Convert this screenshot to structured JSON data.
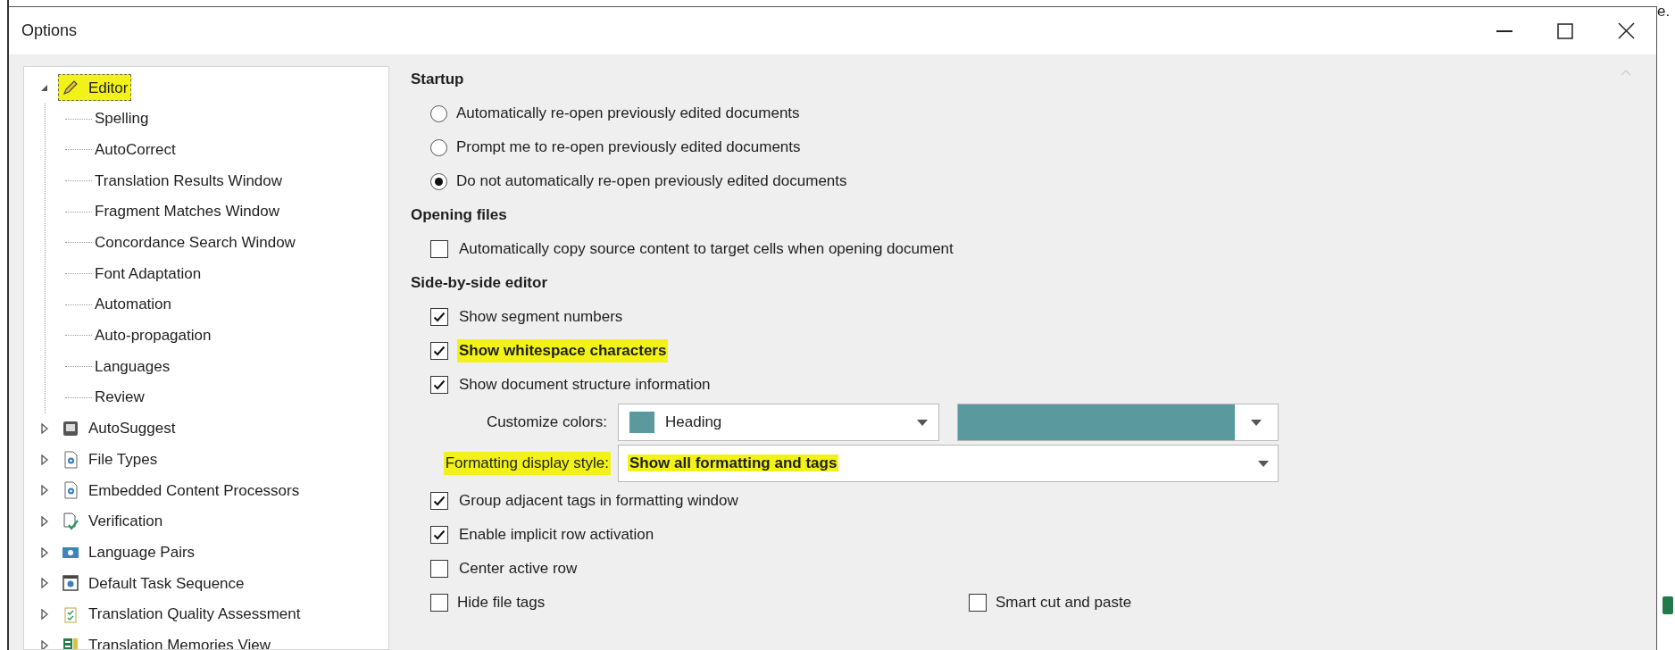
{
  "window": {
    "title": "Options"
  },
  "background_text": "e.",
  "tree": [
    {
      "label": "Editor",
      "expanded": true,
      "selected": true,
      "highlighted": true,
      "children": [
        {
          "label": "Spelling",
          "selected": false
        },
        {
          "label": "AutoCorrect",
          "selected": false
        },
        {
          "label": "Translation Results Window",
          "selected": false
        },
        {
          "label": "Fragment Matches Window",
          "selected": false
        },
        {
          "label": "Concordance Search Window",
          "selected": false
        },
        {
          "label": "Font Adaptation",
          "selected": false
        },
        {
          "label": "Automation",
          "selected": false
        },
        {
          "label": "Auto-propagation",
          "selected": false
        },
        {
          "label": "Languages",
          "selected": false
        },
        {
          "label": "Review",
          "selected": false
        }
      ]
    },
    {
      "label": "AutoSuggest",
      "expanded": false,
      "selected": false,
      "highlighted": false
    },
    {
      "label": "File Types",
      "expanded": false,
      "selected": false,
      "highlighted": false
    },
    {
      "label": "Embedded Content Processors",
      "expanded": false,
      "selected": false,
      "highlighted": false
    },
    {
      "label": "Verification",
      "expanded": false,
      "selected": false,
      "highlighted": false
    },
    {
      "label": "Language Pairs",
      "expanded": false,
      "selected": false,
      "highlighted": false
    },
    {
      "label": "Default Task Sequence",
      "expanded": false,
      "selected": false,
      "highlighted": false
    },
    {
      "label": "Translation Quality Assessment",
      "expanded": false,
      "selected": false,
      "highlighted": false
    },
    {
      "label": "Translation Memories View",
      "expanded": false,
      "selected": false,
      "highlighted": false
    }
  ],
  "sections": [
    {
      "heading": "Startup",
      "items": [
        {
          "kind": "radio",
          "label": "Automatically re-open previously edited documents",
          "selected": false
        },
        {
          "kind": "radio",
          "label": "Prompt me to re-open previously edited documents",
          "selected": false
        },
        {
          "kind": "radio",
          "label": "Do not automatically re-open previously edited documents",
          "selected": true
        }
      ]
    },
    {
      "heading": "Opening files",
      "items": [
        {
          "kind": "checkbox",
          "label": "Automatically copy source content to target cells when opening document",
          "checked": false,
          "highlighted": false
        }
      ]
    },
    {
      "heading": "Side-by-side editor",
      "items": [
        {
          "kind": "checkbox",
          "label": "Show segment numbers",
          "checked": true,
          "highlighted": false
        },
        {
          "kind": "checkbox",
          "label": "Show whitespace characters",
          "checked": true,
          "highlighted": true
        },
        {
          "kind": "checkbox",
          "label": "Show document structure information",
          "checked": true,
          "highlighted": false
        },
        {
          "kind": "colors",
          "label": "Customize colors:",
          "value": "Heading",
          "color": "#5a9a9f"
        },
        {
          "kind": "dropdown",
          "label": "Formatting display style:",
          "value": "Show all formatting and tags",
          "highlighted": true
        },
        {
          "kind": "checkbox",
          "label": "Group adjacent tags in formatting window",
          "checked": true,
          "highlighted": false
        },
        {
          "kind": "checkbox",
          "label": "Enable implicit row activation",
          "checked": true,
          "highlighted": false
        },
        {
          "kind": "checkbox",
          "label": "Center active row",
          "checked": false,
          "highlighted": false
        },
        {
          "kind": "pair",
          "left": {
            "label": "Hide file tags",
            "checked": false
          },
          "right": {
            "label": "Smart cut and paste",
            "checked": false
          }
        }
      ]
    }
  ]
}
